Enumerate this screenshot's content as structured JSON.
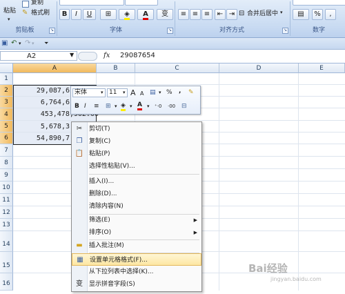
{
  "ribbon": {
    "clipboard": {
      "paste_label": "粘贴",
      "copy_label": "复制",
      "format_painter_label": "格式刷",
      "group_label": "剪贴板"
    },
    "font": {
      "group_label": "字体",
      "bold": "B",
      "italic": "I",
      "underline": "U",
      "font_color_letter": "A",
      "phonetic": "变"
    },
    "alignment": {
      "group_label": "对齐方式",
      "merge_label": "合并后居中"
    },
    "number": {
      "group_label": "数字",
      "percent": "%"
    }
  },
  "formula_bar": {
    "name_box": "A2",
    "fx": "fx",
    "value": "29087654"
  },
  "columns": [
    "A",
    "B",
    "C",
    "D",
    "E"
  ],
  "rows": [
    "1",
    "2",
    "3",
    "4",
    "5",
    "6",
    "7",
    "8",
    "9",
    "10",
    "11",
    "12",
    "13",
    "14",
    "15",
    "16"
  ],
  "cells": {
    "a2": "29,087,6",
    "a3": "6,764,6",
    "a4": "453,478,902.00",
    "a5": "5,678,3",
    "a6": "54,890,7"
  },
  "mini_toolbar": {
    "font_name": "宋体",
    "font_size": "11",
    "grow_font": "A",
    "shrink_font": "A",
    "percent": "%",
    "comma": ",",
    "bold": "B",
    "italic": "I",
    "font_color_letter": "A",
    "increase_decimal": "+.0\n.00",
    "decrease_decimal": ".00\n→.0"
  },
  "context_menu": {
    "items": [
      {
        "label": "剪切(T)",
        "icon": "scissors-icon"
      },
      {
        "label": "复制(C)",
        "icon": "copy-icon"
      },
      {
        "label": "粘贴(P)",
        "icon": "paste-icon"
      },
      {
        "label": "选择性粘贴(V)..."
      },
      {
        "label": "插入(I)..."
      },
      {
        "label": "删除(D)..."
      },
      {
        "label": "清除内容(N)"
      },
      {
        "label": "筛选(E)",
        "submenu": true
      },
      {
        "label": "排序(O)",
        "submenu": true
      },
      {
        "label": "插入批注(M)",
        "icon": "comment-icon"
      },
      {
        "label": "设置单元格格式(F)...",
        "icon": "format-cells-icon",
        "highlighted": true
      },
      {
        "label": "从下拉列表中选择(K)..."
      },
      {
        "label": "显示拼音字段(S)",
        "icon": "phonetic-icon"
      }
    ]
  },
  "watermark": {
    "text": "Bai经验",
    "sub": "jingyan.baidu.com"
  },
  "colors": {
    "selection_header": "#f1b95d",
    "menu_highlight": "#fde7a3",
    "ribbon": "#c9dbf2"
  }
}
